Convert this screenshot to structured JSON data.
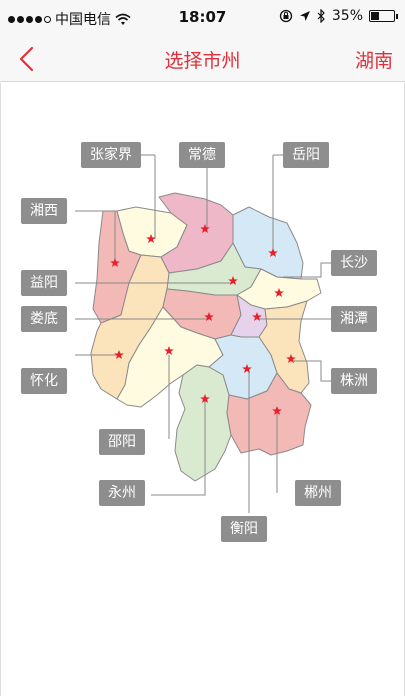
{
  "status_bar": {
    "carrier": "中国电信",
    "time": "18:07",
    "battery": "35%",
    "battery_level": 0.35
  },
  "nav": {
    "title": "选择市州",
    "right": "湖南"
  },
  "map": {
    "cities": [
      "张家界",
      "常德",
      "岳阳",
      "湘西",
      "长沙",
      "益阳",
      "湘潭",
      "娄底",
      "株洲",
      "怀化",
      "邵阳",
      "永州",
      "郴州",
      "衡阳"
    ]
  },
  "colors": {
    "accent": "#e0303a",
    "label_bg": "#8e8e8e",
    "star": "#e8202a"
  },
  "icons": [
    "back-chevron-icon",
    "wifi-icon",
    "lock-rotation-icon",
    "location-icon",
    "bluetooth-icon",
    "battery-icon",
    "star-icon"
  ]
}
